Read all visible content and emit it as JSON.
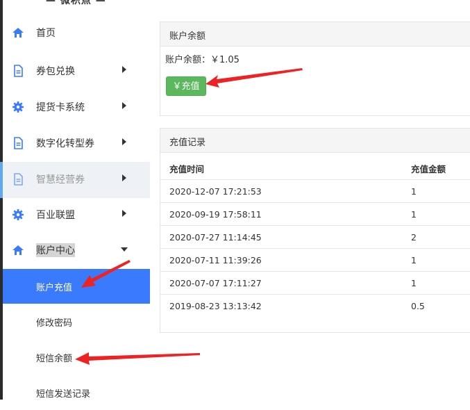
{
  "app": {
    "logo": "— 微积点 —"
  },
  "sidebar": {
    "items": [
      {
        "label": "首页",
        "icon": "home-icon"
      },
      {
        "label": "券包兑换",
        "icon": "document-icon"
      },
      {
        "label": "提货卡系统",
        "icon": "gear-icon"
      },
      {
        "label": "数字化转型券",
        "icon": "document-icon"
      },
      {
        "label": "智慧经营券",
        "icon": "document-icon"
      },
      {
        "label": "百业联盟",
        "icon": "gear-icon"
      },
      {
        "label": "账户中心",
        "icon": "home-icon"
      }
    ],
    "subitems": [
      {
        "label": "账户充值",
        "active": true
      },
      {
        "label": "修改密码"
      },
      {
        "label": "短信余额"
      },
      {
        "label": "短信发送记录"
      }
    ]
  },
  "balance_panel": {
    "title": "账户余额",
    "balance_text": "账户余额：￥1.05",
    "recharge_button": "￥充值"
  },
  "records_panel": {
    "title": "充值记录",
    "columns": [
      "充值时间",
      "充值金额"
    ],
    "rows": [
      [
        "2020-12-07 17:21:53",
        "1"
      ],
      [
        "2020-09-19 17:58:11",
        "1"
      ],
      [
        "2020-07-27 11:14:45",
        "2"
      ],
      [
        "2020-07-11 11:39:26",
        "1"
      ],
      [
        "2020-07-07 17:11:27",
        "1"
      ],
      [
        "2019-08-23 13:13:42",
        "0.5"
      ]
    ]
  },
  "colors": {
    "active_nav": "#3a7bfd",
    "button": "#5cb85c",
    "icon": "#3a7bfd",
    "annotation_arrow": "#ee2222"
  }
}
